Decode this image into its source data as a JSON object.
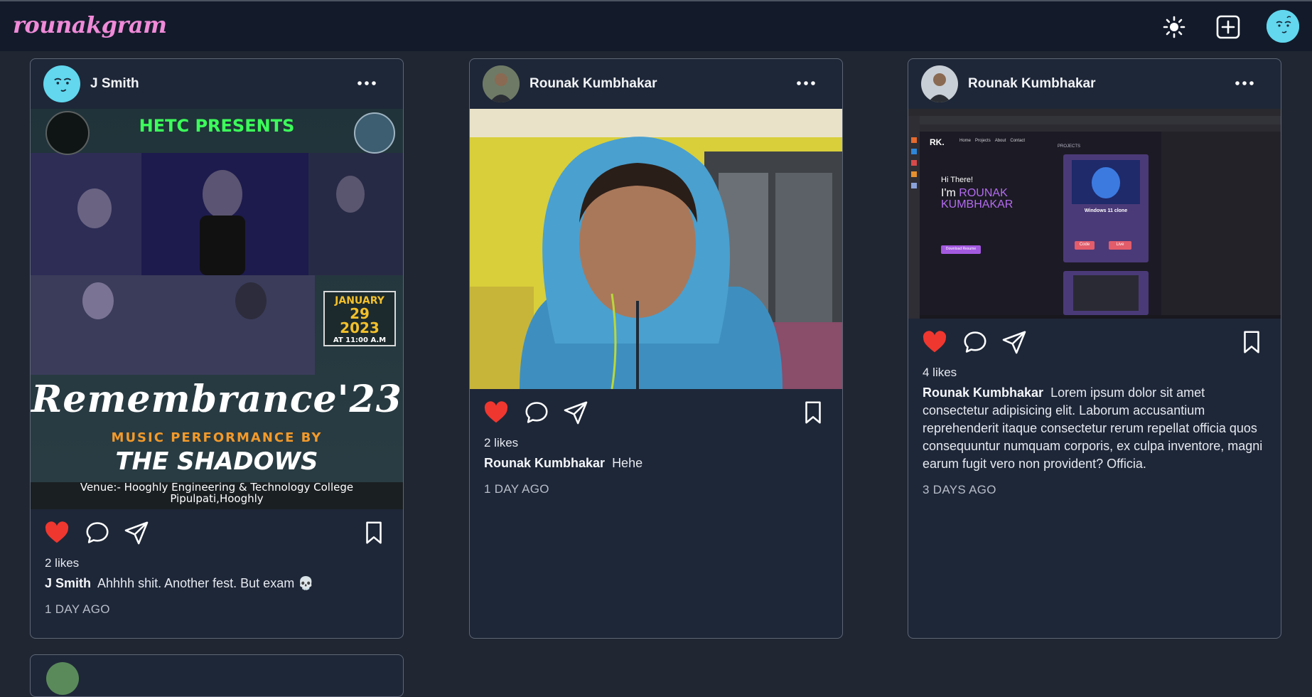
{
  "app": {
    "logo": "rounakgram"
  },
  "posts": [
    {
      "username": "J Smith",
      "likes": "2 likes",
      "caption_user": "J Smith",
      "caption_text": "Ahhhh shit. Another fest. But exam 💀",
      "time": "1 DAY AGO",
      "poster": {
        "presents": "HETC PRESENTS",
        "title": "Remembrance'23",
        "subtitle": "MUSIC PERFORMANCE BY",
        "band": "THE SHADOWS",
        "date_month": "JANUARY",
        "date_day": "29",
        "date_year": "2023",
        "date_time": "AT 11:00 A.M",
        "venue_line1": "Venue:- Hooghly Engineering & Technology College",
        "venue_line2": "Pipulpati,Hooghly"
      }
    },
    {
      "username": "Rounak Kumbhakar",
      "likes": "2 likes",
      "caption_user": "Rounak Kumbhakar",
      "caption_text": "Hehe",
      "time": "1 DAY AGO"
    },
    {
      "username": "Rounak Kumbhakar",
      "likes": "4 likes",
      "caption_user": "Rounak Kumbhakar",
      "caption_text": "Lorem ipsum dolor sit amet consectetur adipisicing elit. Laborum accusantium reprehenderit itaque consectetur rerum repellat officia quos consequuntur numquam corporis, ex culpa inventore, magni earum fugit vero non provident? Officia.",
      "time": "3 DAYS AGO",
      "screenshot": {
        "greeting": "Hi There!",
        "im": "I'm",
        "name1": "ROUNAK",
        "name2": "KUMBHAKAR",
        "brand": "RK.",
        "nav_home": "Home",
        "nav_projects": "Projects",
        "nav_about": "About",
        "nav_contact": "Contact",
        "projects": "PROJECTS",
        "project_title": "Windows 11 clone",
        "code_btn": "Code",
        "live_btn": "Live",
        "resume_btn": "Download Resume"
      }
    }
  ],
  "colors": {
    "background": "#202733",
    "topbar": "#131b2b",
    "card": "#1e2738",
    "logo": "#f08ad8",
    "heart": "#f0372f"
  }
}
